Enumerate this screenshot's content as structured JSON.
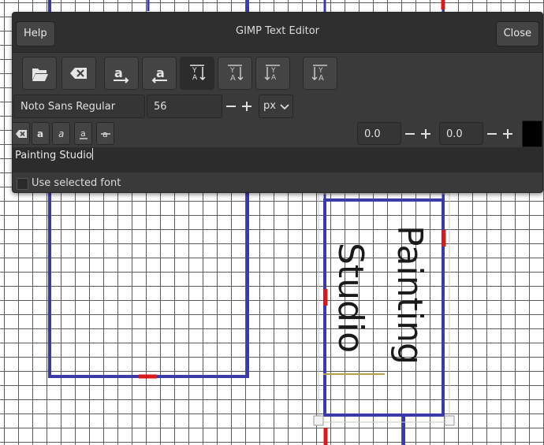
{
  "dialog": {
    "title": "GIMP Text Editor",
    "help_label": "Help",
    "close_label": "Close"
  },
  "toolbar": {
    "buttons": [
      {
        "icon": "open-file-icon"
      },
      {
        "icon": "clear-text-icon"
      },
      {
        "icon": "text-direction-ltr-icon"
      },
      {
        "icon": "text-direction-rtl-icon"
      },
      {
        "icon": "text-direction-vertical-rtl-upright-icon"
      },
      {
        "icon": "text-direction-vertical-rtl-mixed-icon"
      },
      {
        "icon": "text-direction-vertical-ltr-upright-icon"
      },
      {
        "icon": "text-direction-vertical-ltr-mixed-icon"
      }
    ]
  },
  "font": {
    "family": "Noto Sans Regular",
    "size": "56",
    "unit": "px"
  },
  "style": {
    "baseline": "0.0",
    "kerning": "0.0",
    "color": "#000000"
  },
  "editor": {
    "text": "Painting Studio"
  },
  "options": {
    "use_selected_font_label": "Use selected font",
    "use_selected_font_checked": false
  },
  "canvas": {
    "text_column_1": "Painting",
    "text_column_2": "Studio"
  },
  "colors": {
    "guide_blue": "#3a3aa8",
    "marker_red": "#d91a1a",
    "dialog_bg": "#3a3a3a"
  }
}
